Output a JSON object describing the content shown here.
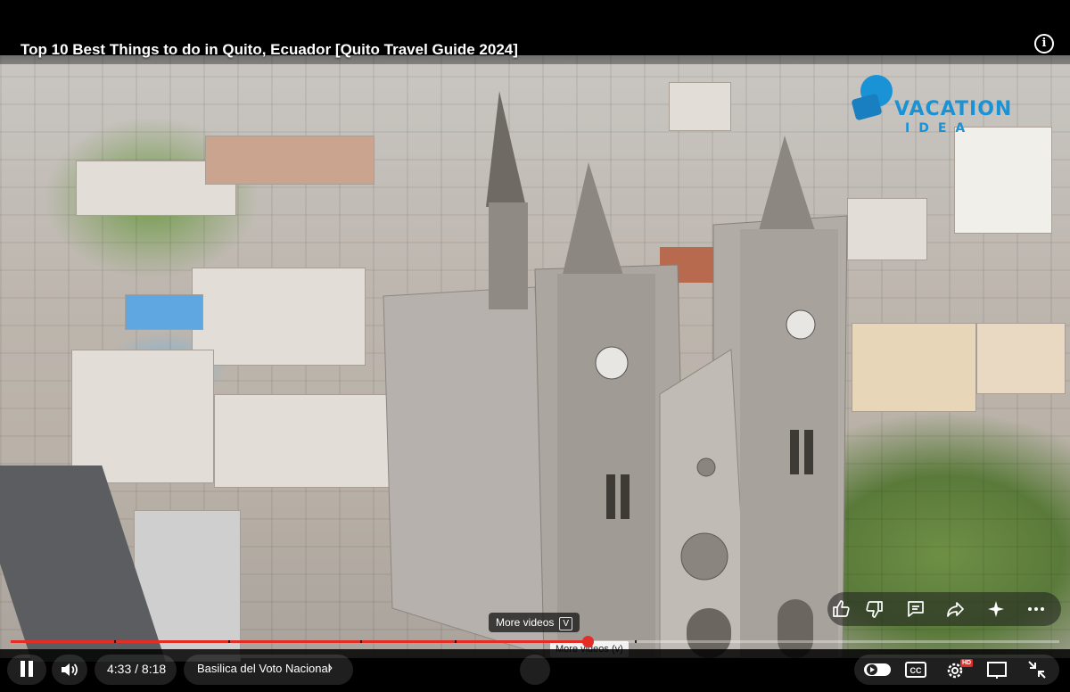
{
  "video": {
    "title": "Top 10 Best Things to do in Quito, Ecuador [Quito Travel Guide 2024]",
    "progress_fraction": 0.55,
    "brand_logo_line1": "VACATION",
    "brand_logo_line2": "IDEA"
  },
  "overlay": {
    "more_videos_label": "More videos",
    "more_videos_key": "V",
    "tooltip": "More videos (v)"
  },
  "controls": {
    "current_time": "4:33",
    "separator": " / ",
    "duration": "8:18",
    "chapter": "Basilica del Voto Nacional",
    "hd_badge": "HD"
  },
  "colors": {
    "progress": "#e52d27",
    "brand": "#1a93d6"
  },
  "icons": {
    "info": "info-icon",
    "like": "thumbs-up-icon",
    "dislike": "thumbs-down-icon",
    "comment": "comment-icon",
    "share": "share-icon",
    "ask": "sparkle-icon",
    "more": "more-icon",
    "pause": "pause-icon",
    "volume": "volume-icon",
    "autoplay": "autoplay-toggle-icon",
    "captions": "captions-icon",
    "settings": "settings-gear-icon",
    "miniplayer": "miniplayer-icon",
    "fullscreen": "exit-fullscreen-icon"
  }
}
